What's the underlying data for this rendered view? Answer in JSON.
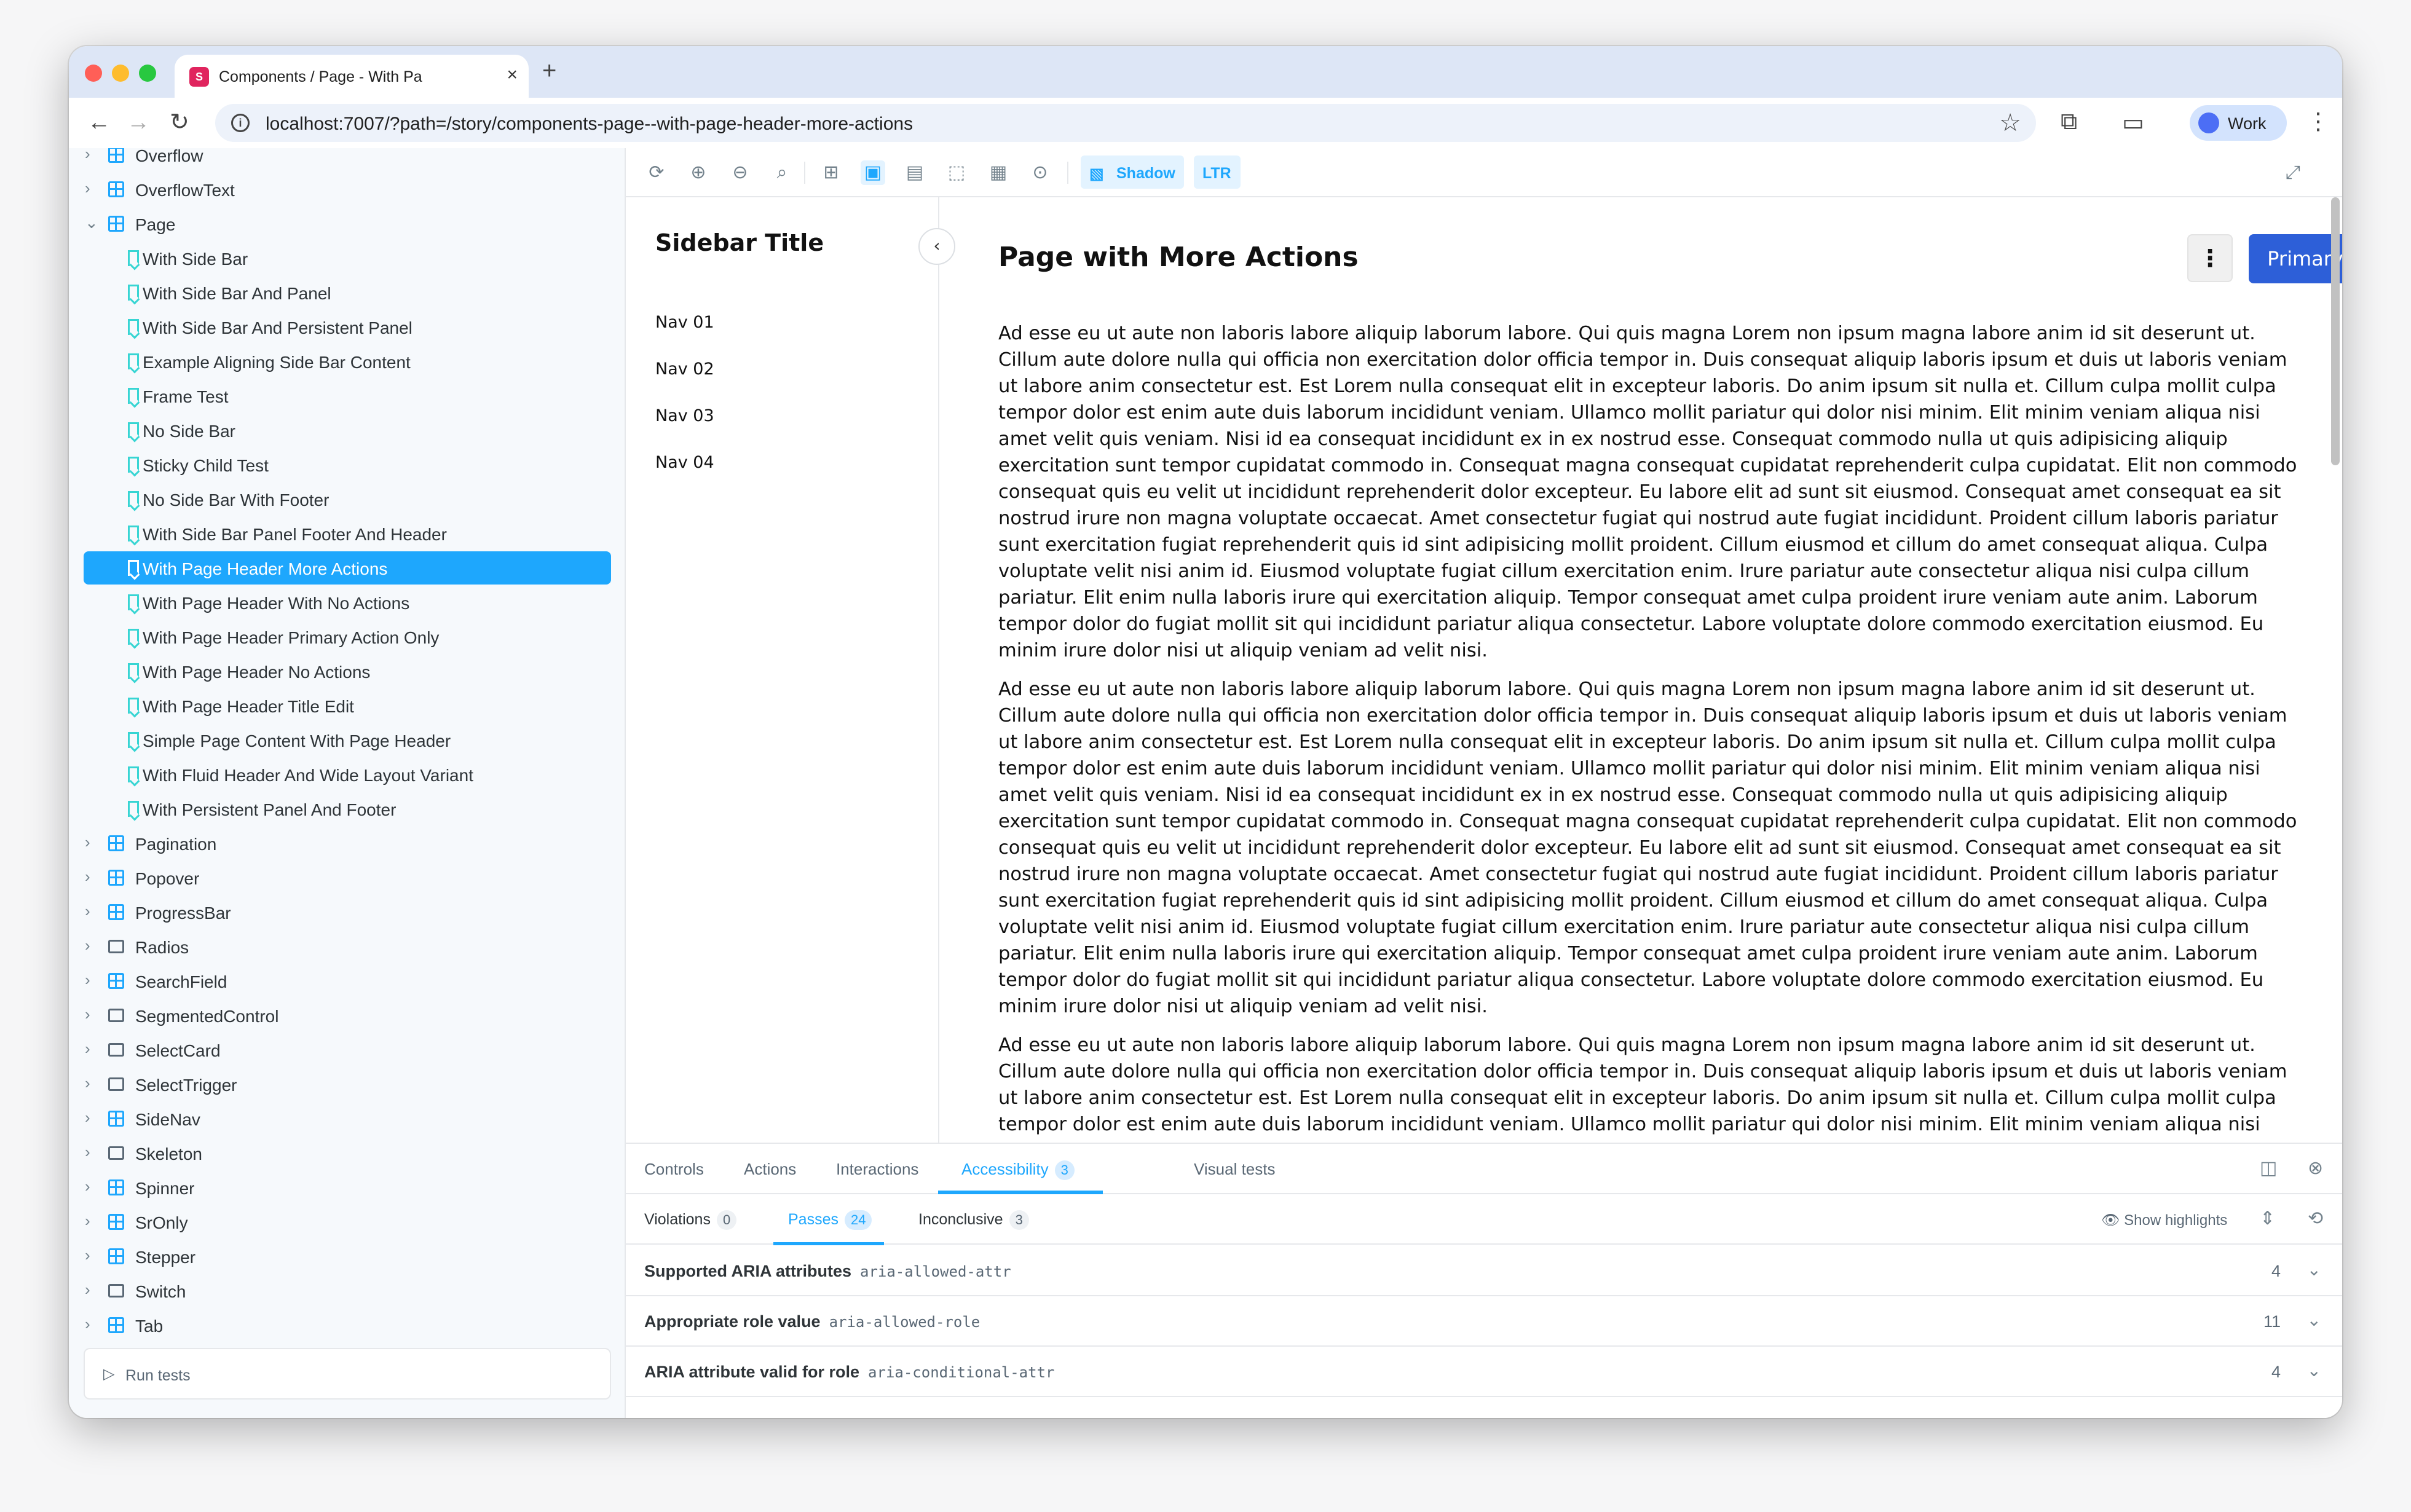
{
  "browser": {
    "tab_title": "Components / Page - With Pa",
    "tab_close": "×",
    "new_tab": "+",
    "url": "localhost:7007/?path=/story/components-page--with-page-header-more-actions",
    "profile_label": "Work",
    "back": "←",
    "forward": "→",
    "reload": "↻",
    "star": "☆",
    "menu": "⋮",
    "info": "i"
  },
  "sidebar": {
    "items": [
      {
        "label": "Overflow",
        "type": "component"
      },
      {
        "label": "OverflowText",
        "type": "component"
      },
      {
        "label": "Page",
        "type": "component-open"
      },
      {
        "label": "With Side Bar",
        "type": "story"
      },
      {
        "label": "With Side Bar And Panel",
        "type": "story"
      },
      {
        "label": "With Side Bar And Persistent Panel",
        "type": "story"
      },
      {
        "label": "Example Aligning Side Bar Content",
        "type": "story"
      },
      {
        "label": "Frame Test",
        "type": "story"
      },
      {
        "label": "No Side Bar",
        "type": "story"
      },
      {
        "label": "Sticky Child Test",
        "type": "story"
      },
      {
        "label": "No Side Bar With Footer",
        "type": "story"
      },
      {
        "label": "With Side Bar Panel Footer And Header",
        "type": "story"
      },
      {
        "label": "With Page Header More Actions",
        "type": "story-selected"
      },
      {
        "label": "With Page Header With No Actions",
        "type": "story"
      },
      {
        "label": "With Page Header Primary Action Only",
        "type": "story"
      },
      {
        "label": "With Page Header No Actions",
        "type": "story"
      },
      {
        "label": "With Page Header Title Edit",
        "type": "story"
      },
      {
        "label": "Simple Page Content With Page Header",
        "type": "story"
      },
      {
        "label": "With Fluid Header And Wide Layout Variant",
        "type": "story"
      },
      {
        "label": "With Persistent Panel And Footer",
        "type": "story"
      },
      {
        "label": "Pagination",
        "type": "component"
      },
      {
        "label": "Popover",
        "type": "component"
      },
      {
        "label": "ProgressBar",
        "type": "component"
      },
      {
        "label": "Radios",
        "type": "folder"
      },
      {
        "label": "SearchField",
        "type": "component"
      },
      {
        "label": "SegmentedControl",
        "type": "folder"
      },
      {
        "label": "SelectCard",
        "type": "folder"
      },
      {
        "label": "SelectTrigger",
        "type": "folder"
      },
      {
        "label": "SideNav",
        "type": "component"
      },
      {
        "label": "Skeleton",
        "type": "folder"
      },
      {
        "label": "Spinner",
        "type": "component"
      },
      {
        "label": "SrOnly",
        "type": "component"
      },
      {
        "label": "Stepper",
        "type": "component"
      },
      {
        "label": "Switch",
        "type": "folder"
      },
      {
        "label": "Tab",
        "type": "component"
      }
    ],
    "run_tests_label": "Run tests"
  },
  "storybook_toolbar": {
    "shadow_label": "Shadow",
    "ltr_label": "LTR"
  },
  "preview": {
    "sidebar_title": "Sidebar Title",
    "collapse_icon": "‹",
    "nav_items": [
      "Nav 01",
      "Nav 02",
      "Nav 03",
      "Nav 04"
    ],
    "page_title": "Page with More Actions",
    "more_icon": "⋮",
    "primary_label": "Primary",
    "paragraphs": [
      "Ad esse eu ut aute non laboris labore aliquip laborum labore. Qui quis magna Lorem non ipsum magna labore anim id sit deserunt ut. Cillum aute dolore nulla qui officia non exercitation dolor officia tempor in. Duis consequat aliquip laboris ipsum et duis ut laboris veniam ut labore anim consectetur est. Est Lorem nulla consequat elit in excepteur laboris. Do anim ipsum sit nulla et. Cillum culpa mollit culpa tempor dolor est enim aute duis laborum incididunt veniam. Ullamco mollit pariatur qui dolor nisi minim. Elit minim veniam aliqua nisi amet velit quis veniam. Nisi id ea consequat incididunt ex in ex nostrud esse. Consequat commodo nulla ut quis adipisicing aliquip exercitation sunt tempor cupidatat commodo in. Consequat magna consequat cupidatat reprehenderit culpa cupidatat. Elit non commodo consequat quis eu velit ut incididunt reprehenderit dolor excepteur. Eu labore elit ad sunt sit eiusmod. Consequat amet consequat ea sit nostrud irure non magna voluptate occaecat. Amet consectetur fugiat qui nostrud aute fugiat incididunt. Proident cillum laboris pariatur sunt exercitation fugiat reprehenderit quis id sint adipisicing mollit proident. Cillum eiusmod et cillum do amet consequat aliqua. Culpa voluptate velit nisi anim id. Eiusmod voluptate fugiat cillum exercitation enim. Irure pariatur aute consectetur aliqua nisi culpa cillum pariatur. Elit enim nulla laboris irure qui exercitation aliquip. Tempor consequat amet culpa proident irure veniam aute anim. Laborum tempor dolor do fugiat mollit sit qui incididunt pariatur aliqua consectetur. Labore voluptate dolore commodo exercitation eiusmod. Eu minim irure dolor nisi ut aliquip veniam ad velit nisi.",
      "Ad esse eu ut aute non laboris labore aliquip laborum labore. Qui quis magna Lorem non ipsum magna labore anim id sit deserunt ut. Cillum aute dolore nulla qui officia non exercitation dolor officia tempor in. Duis consequat aliquip laboris ipsum et duis ut laboris veniam ut labore anim consectetur est. Est Lorem nulla consequat elit in excepteur laboris. Do anim ipsum sit nulla et. Cillum culpa mollit culpa tempor dolor est enim aute duis laborum incididunt veniam. Ullamco mollit pariatur qui dolor nisi minim. Elit minim veniam aliqua nisi amet velit quis veniam. Nisi id ea consequat incididunt ex in ex nostrud esse. Consequat commodo nulla ut quis adipisicing aliquip exercitation sunt tempor cupidatat commodo in. Consequat magna consequat cupidatat reprehenderit culpa cupidatat. Elit non commodo consequat quis eu velit ut incididunt reprehenderit dolor excepteur. Eu labore elit ad sunt sit eiusmod. Consequat amet consequat ea sit nostrud irure non magna voluptate occaecat. Amet consectetur fugiat qui nostrud aute fugiat incididunt. Proident cillum laboris pariatur sunt exercitation fugiat reprehenderit quis id sint adipisicing mollit proident. Cillum eiusmod et cillum do amet consequat aliqua. Culpa voluptate velit nisi anim id. Eiusmod voluptate fugiat cillum exercitation enim. Irure pariatur aute consectetur aliqua nisi culpa cillum pariatur. Elit enim nulla laboris irure qui exercitation aliquip. Tempor consequat amet culpa proident irure veniam aute anim. Laborum tempor dolor do fugiat mollit sit qui incididunt pariatur aliqua consectetur. Labore voluptate dolore commodo exercitation eiusmod. Eu minim irure dolor nisi ut aliquip veniam ad velit nisi.",
      "Ad esse eu ut aute non laboris labore aliquip laborum labore. Qui quis magna Lorem non ipsum magna labore anim id sit deserunt ut. Cillum aute dolore nulla qui officia non exercitation dolor officia tempor in. Duis consequat aliquip laboris ipsum et duis ut laboris veniam ut labore anim consectetur est. Est Lorem nulla consequat elit in excepteur laboris. Do anim ipsum sit nulla et. Cillum culpa mollit culpa tempor dolor est enim aute duis laborum incididunt veniam. Ullamco mollit pariatur qui dolor nisi minim. Elit minim veniam aliqua nisi amet velit quis veniam. Nisi id ea consequat incididunt ex in ex nostrud esse. Consequat commodo nulla ut quis adipisicing aliquip exercitation sunt tempor cupidatat commodo in. Consequat magna consequat cupidatat reprehenderit culpa cupidatat. Elit non commodo consequat quis eu velit ut incididunt reprehenderit dolor"
    ]
  },
  "addons": {
    "tabs": [
      {
        "label": "Controls"
      },
      {
        "label": "Actions"
      },
      {
        "label": "Interactions"
      },
      {
        "label": "Accessibility",
        "badge": "3"
      },
      {
        "label": "Visual tests"
      }
    ],
    "subtabs": [
      {
        "label": "Violations",
        "count": "0"
      },
      {
        "label": "Passes",
        "count": "24"
      },
      {
        "label": "Inconclusive",
        "count": "3"
      }
    ],
    "show_highlights_label": "Show highlights",
    "rules": [
      {
        "title": "Supported ARIA attributes",
        "code": "aria-allowed-attr",
        "count": "4"
      },
      {
        "title": "Appropriate role value",
        "code": "aria-allowed-role",
        "count": "11"
      },
      {
        "title": "ARIA attribute valid for role",
        "code": "aria-conditional-attr",
        "count": "4"
      }
    ]
  },
  "colors": {
    "accent": "#1ea7fd",
    "primary_button": "#2d5fd8",
    "story_icon": "#37d5d3"
  }
}
